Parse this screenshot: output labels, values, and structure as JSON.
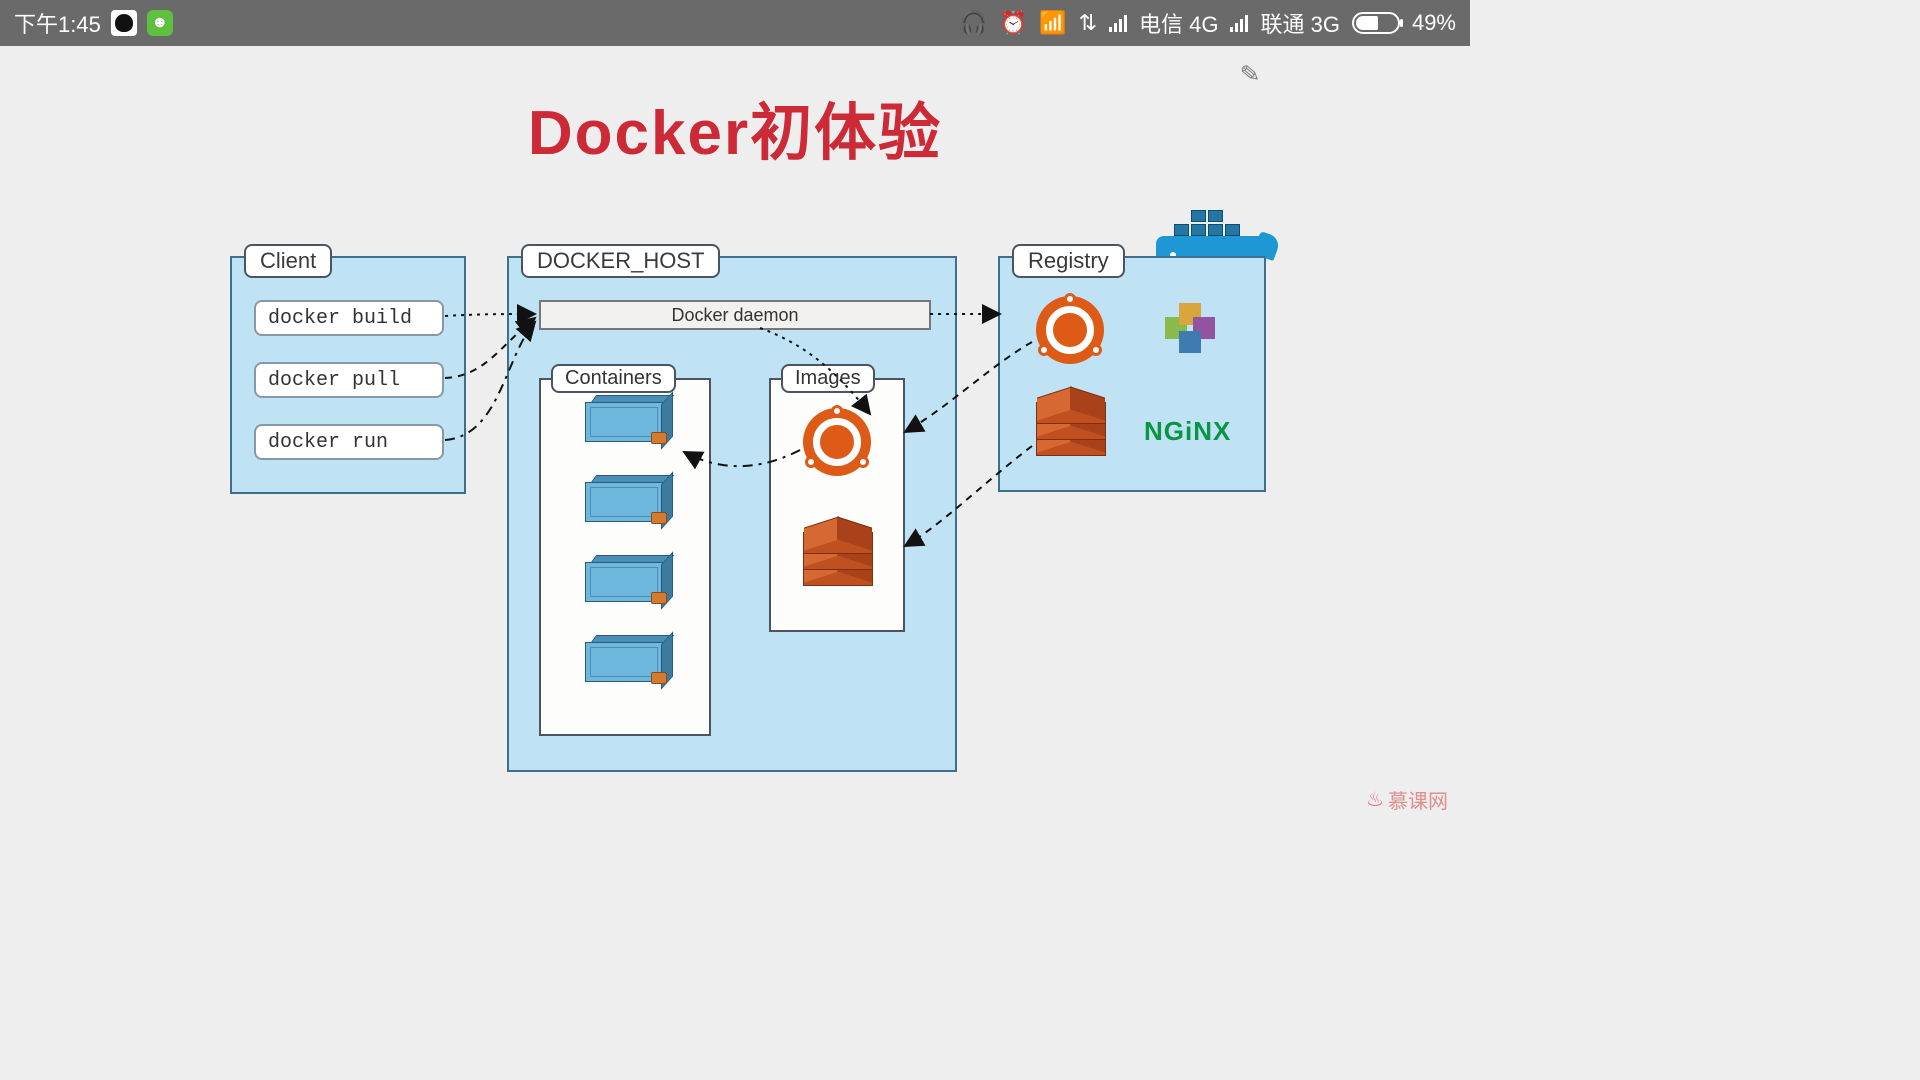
{
  "statusbar": {
    "time": "下午1:45",
    "carrier1": "电信 4G",
    "carrier2": "联通 3G",
    "battery": "49%"
  },
  "title": "Docker初体验",
  "client": {
    "label": "Client",
    "commands": [
      "docker build",
      "docker pull",
      "docker run"
    ]
  },
  "host": {
    "label": "DOCKER_HOST",
    "daemon": "Docker daemon",
    "containers_label": "Containers",
    "images_label": "Images"
  },
  "registry": {
    "label": "Registry",
    "nginx": "NGiNX"
  },
  "brand": "慕课网"
}
